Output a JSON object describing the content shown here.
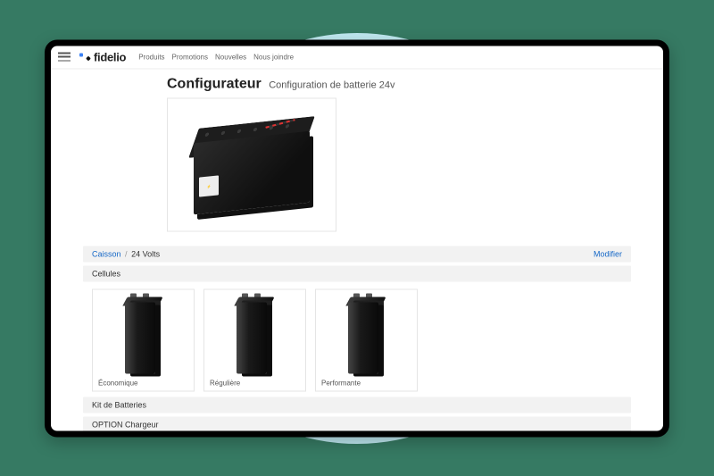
{
  "brand": "fidelio",
  "nav": {
    "items": [
      "Produits",
      "Promotions",
      "Nouvelles",
      "Nous joindre"
    ]
  },
  "page": {
    "title": "Configurateur",
    "subtitle": "Configuration de batterie 24v"
  },
  "breadcrumb": {
    "part1": "Caisson",
    "part2": "24 Volts",
    "modify": "Modifier"
  },
  "section_cells": "Cellules",
  "cells": [
    {
      "label": "Économique"
    },
    {
      "label": "Régulière"
    },
    {
      "label": "Performante"
    }
  ],
  "section_kit": "Kit de Batteries",
  "section_option": "OPTION Chargeur"
}
